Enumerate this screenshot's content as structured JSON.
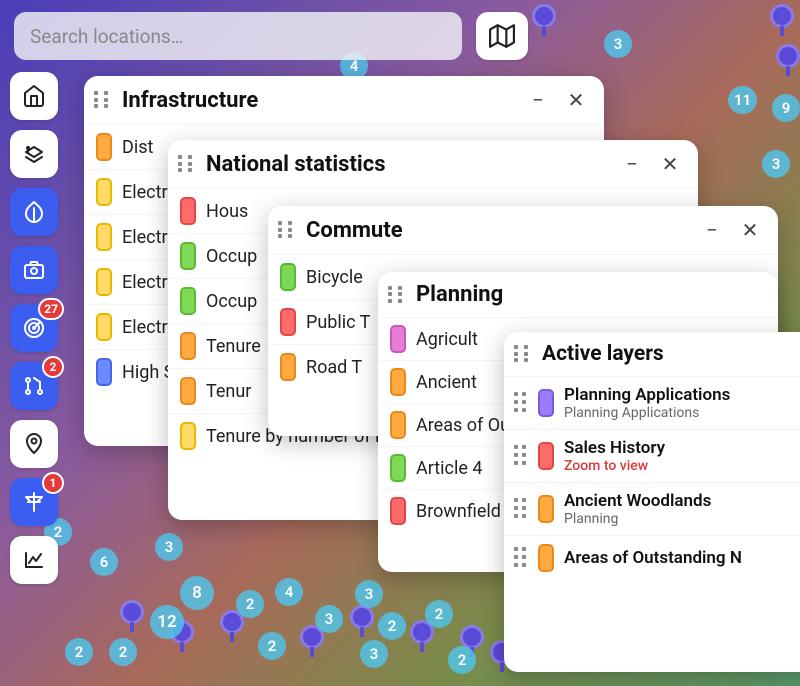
{
  "search": {
    "placeholder": "Search locations…"
  },
  "toolbar": {
    "buttons": [
      {
        "name": "home-icon",
        "badge": null
      },
      {
        "name": "layers-icon",
        "badge": null
      },
      {
        "name": "leaf-icon",
        "badge": null
      },
      {
        "name": "camera-icon",
        "badge": null
      },
      {
        "name": "radar-icon",
        "badge": "27"
      },
      {
        "name": "git-icon",
        "badge": "2"
      },
      {
        "name": "pin-icon",
        "badge": null
      },
      {
        "name": "pylon-icon",
        "badge": "1"
      },
      {
        "name": "chart-icon",
        "badge": null
      }
    ]
  },
  "panels": {
    "infrastructure": {
      "title": "Infrastructure",
      "items": [
        {
          "color": "orange",
          "label": "Dist"
        },
        {
          "color": "yellow",
          "label": "Electrical Network"
        },
        {
          "color": "yellow",
          "label": "Electrical Network"
        },
        {
          "color": "yellow",
          "label": "Electrical Network"
        },
        {
          "color": "yellow",
          "label": "Electrical Network"
        },
        {
          "color": "blue",
          "label": "High Speed"
        }
      ]
    },
    "national_stats": {
      "title": "National statistics",
      "items": [
        {
          "color": "red",
          "label": "Hous"
        },
        {
          "color": "green",
          "label": "Occup"
        },
        {
          "color": "green",
          "label": "Occup"
        },
        {
          "color": "orange",
          "label": "Tenure"
        },
        {
          "color": "orange",
          "label": "Tenur"
        },
        {
          "color": "yellow",
          "label": "Tenure by number of rooms"
        }
      ]
    },
    "commute": {
      "title": "Commute",
      "items": [
        {
          "color": "green",
          "label": "Bicycle"
        },
        {
          "color": "red",
          "label": "Public T"
        },
        {
          "color": "orange",
          "label": "Road T"
        }
      ]
    },
    "planning": {
      "title": "Planning",
      "items": [
        {
          "color": "magenta",
          "label": "Agricult"
        },
        {
          "color": "orange",
          "label": "Ancient"
        },
        {
          "color": "orange",
          "label": "Areas of Outstanding"
        },
        {
          "color": "green",
          "label": "Article 4"
        },
        {
          "color": "red",
          "label": "Brownfield"
        }
      ]
    },
    "active": {
      "title": "Active layers",
      "items": [
        {
          "color": "purple",
          "t1": "Planning Applications",
          "t2": "Planning Applications",
          "warn": false
        },
        {
          "color": "red",
          "t1": "Sales History",
          "t2": "Zoom to view",
          "warn": true
        },
        {
          "color": "orange",
          "t1": "Ancient Woodlands",
          "t2": "Planning",
          "warn": false
        },
        {
          "color": "orange",
          "t1": "Areas of Outstanding N",
          "t2": "",
          "warn": false
        }
      ]
    }
  },
  "map_bubbles": [
    "3",
    "11",
    "9",
    "3",
    "4",
    "2",
    "6",
    "3",
    "2",
    "2",
    "8",
    "12",
    "2",
    "2",
    "4",
    "3",
    "3",
    "2",
    "3",
    "2",
    "2"
  ]
}
